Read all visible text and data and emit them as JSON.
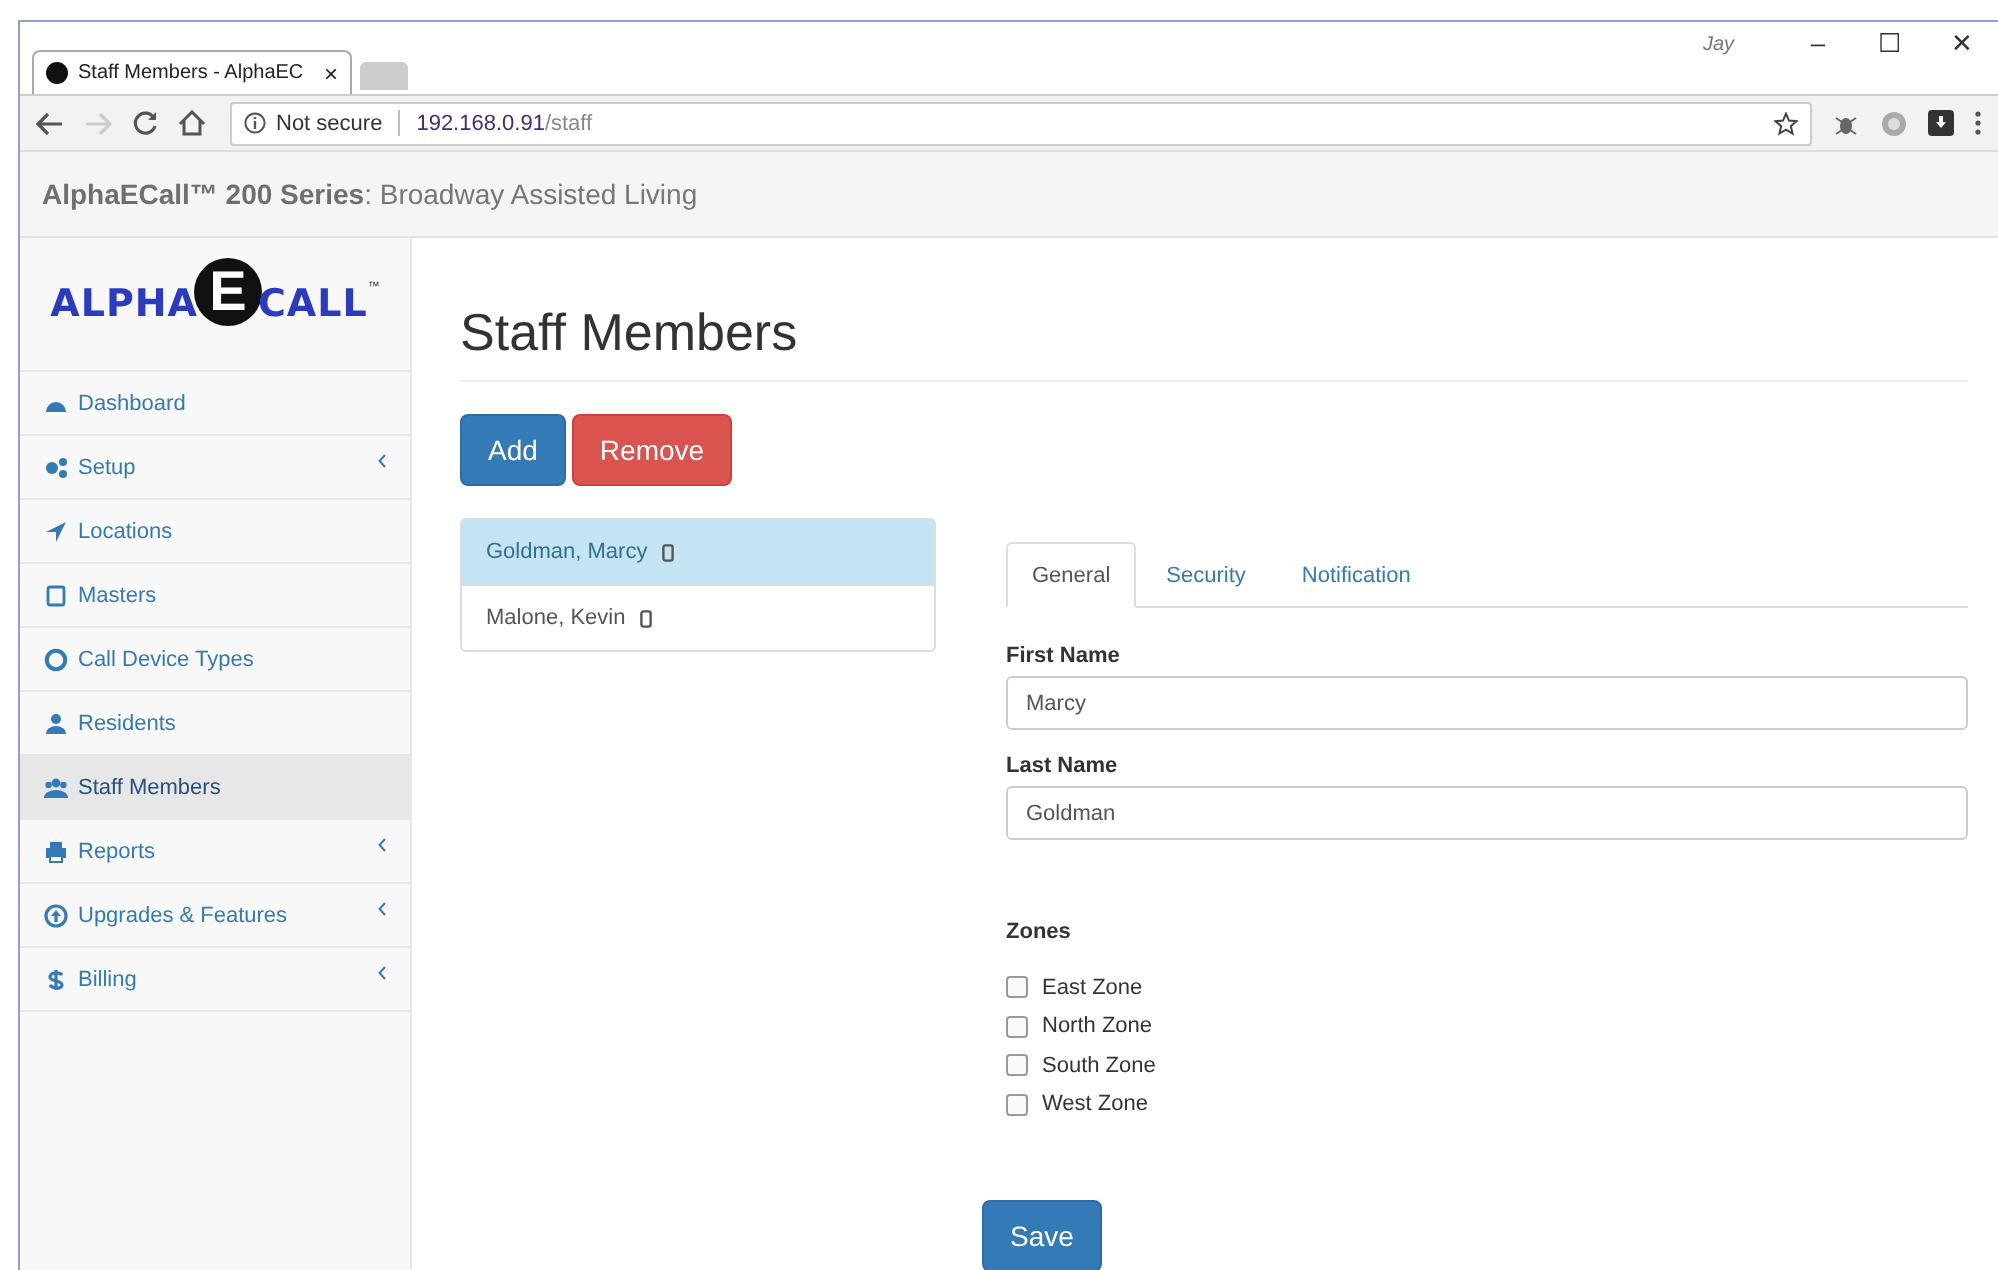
{
  "browser": {
    "tab_title": "Staff Members - AlphaEC",
    "tab_close": "×",
    "security": "Not secure",
    "url_host": "192.168.0.91",
    "url_path": "/staff",
    "profile": "Jay",
    "window_controls": [
      "–",
      "☐",
      "✕"
    ]
  },
  "header": {
    "brand": "AlphaECall™ 200 Series",
    "subtitle": ": Broadway Assisted Living"
  },
  "logo": {
    "left": "ALPHA",
    "mark": "E",
    "right": "CALL",
    "tm": "™"
  },
  "sidebar": {
    "items": [
      {
        "label": "Dashboard",
        "selected": false,
        "submenu": false
      },
      {
        "label": "Setup",
        "selected": false,
        "submenu": true
      },
      {
        "label": "Locations",
        "selected": false,
        "submenu": false
      },
      {
        "label": "Masters",
        "selected": false,
        "submenu": false
      },
      {
        "label": "Call Device Types",
        "selected": false,
        "submenu": false
      },
      {
        "label": "Residents",
        "selected": false,
        "submenu": false
      },
      {
        "label": "Staff Members",
        "selected": true,
        "submenu": false
      },
      {
        "label": "Reports",
        "selected": false,
        "submenu": true
      },
      {
        "label": "Upgrades & Features",
        "selected": false,
        "submenu": true
      },
      {
        "label": "Billing",
        "selected": false,
        "submenu": true
      }
    ]
  },
  "page": {
    "title": "Staff Members",
    "add": "Add",
    "remove": "Remove",
    "save": "Save"
  },
  "staff": [
    {
      "name": "Goldman, Marcy",
      "selected": true
    },
    {
      "name": "Malone, Kevin",
      "selected": false
    }
  ],
  "tabs": [
    {
      "label": "General",
      "selected": true
    },
    {
      "label": "Security",
      "selected": false
    },
    {
      "label": "Notification",
      "selected": false
    }
  ],
  "form": {
    "first_name_label": "First Name",
    "first_name": "Marcy",
    "last_name_label": "Last Name",
    "last_name": "Goldman",
    "zones_label": "Zones"
  },
  "zones": [
    {
      "label": "East Zone",
      "checked": false
    },
    {
      "label": "North Zone",
      "checked": false
    },
    {
      "label": "South Zone",
      "checked": false
    },
    {
      "label": "West Zone",
      "checked": false
    }
  ]
}
